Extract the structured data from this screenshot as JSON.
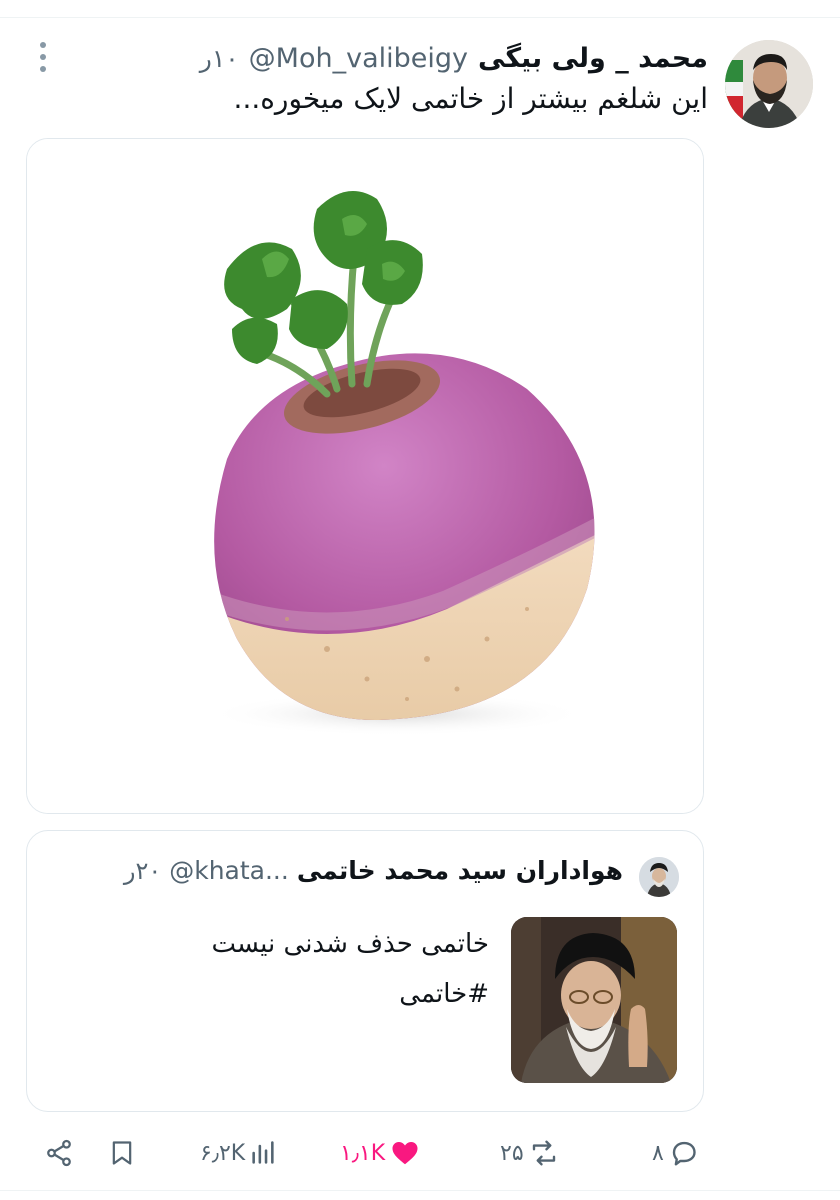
{
  "tweet": {
    "display_name": "محمد _ ولی بیگی",
    "handle": "@Moh_valibeigy",
    "timestamp": "۱۰ر",
    "text": "این شلغم  بیشتر از خاتمی لایک میخوره...",
    "avatar_icon": "user-avatar-photo",
    "media_icon": "turnip-photo"
  },
  "quote": {
    "display_name": "هواداران سید محمد خاتمی",
    "handle": "@khata...",
    "timestamp": "۲۰ر",
    "text": "خاتمی حذف شدنی نیست",
    "hashtag": "#خاتمی",
    "avatar_icon": "quote-avatar-photo",
    "thumb_icon": "cleric-photo"
  },
  "actions": {
    "replies": "۸",
    "reposts": "۲۵",
    "likes": "۱٫۱K",
    "views": "۶٫۲K"
  },
  "colors": {
    "like": "#f91880",
    "muted": "#536471",
    "text": "#0f1419",
    "border": "#e1e8ed"
  }
}
